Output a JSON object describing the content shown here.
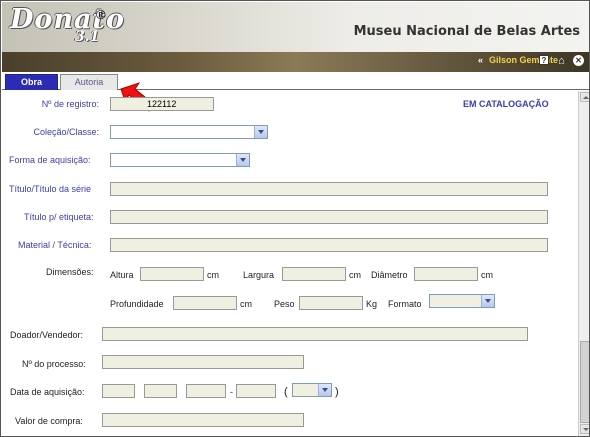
{
  "app": {
    "logo": "Donato",
    "logo_reg": "®",
    "logo_version": "3.1",
    "museum": "Museu Nacional de Belas Artes"
  },
  "topbar": {
    "chevron": "«",
    "user": "Gilson Gemente",
    "help_glyph": "?",
    "home_glyph": "⌂",
    "close_glyph": "✕"
  },
  "tabs": [
    "Obra",
    "Autoria"
  ],
  "status": "EM CATALOGAÇÃO",
  "form": {
    "registro_label": "Nº de registro:",
    "registro_value": "122112",
    "colecao_label": "Coleção/Classe:",
    "forma_label": "Forma de aquisição:",
    "titulo_serie_label": "Título/Título da série",
    "titulo_etiqueta_label": "Título p/ etiqueta:",
    "material_label": "Material / Técnica:",
    "dimensoes_label": "Dimensões:",
    "altura_label": "Altura",
    "largura_label": "Largura",
    "diametro_label": "Diâmetro",
    "profundidade_label": "Profundidade",
    "peso_label": "Peso",
    "formato_label": "Formato",
    "unit_cm": "cm",
    "unit_kg": "Kg",
    "doador_label": "Doador/Vendedor:",
    "processo_label": "Nº do processo:",
    "data_label": "Data de aquisição:",
    "date_dash": "-",
    "paren_open": "(",
    "paren_close": ")",
    "valor_label": "Valor de compra:"
  }
}
